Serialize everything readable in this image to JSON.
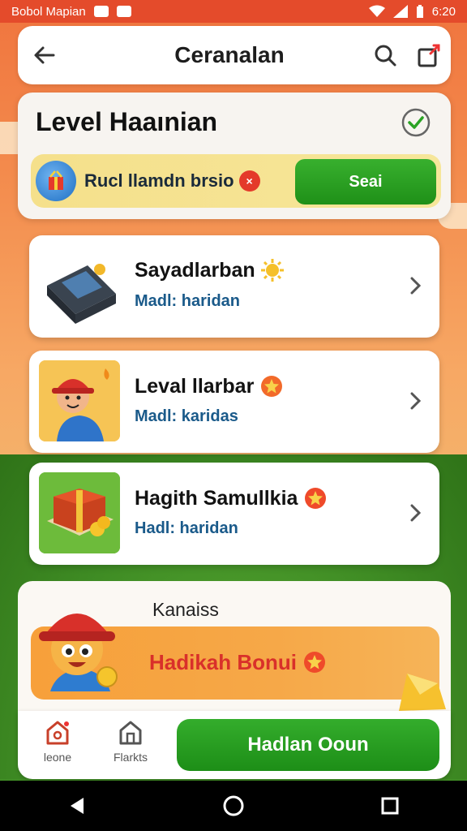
{
  "status_bar": {
    "left_text": "Bobol Mapian",
    "time": "6:20"
  },
  "header": {
    "title": "Ceranalan"
  },
  "level": {
    "title": "Level Haaınian",
    "promo_text": "Rucl llamdn brsio",
    "promo_badge": "×",
    "send_label": "Seai"
  },
  "tasks": [
    {
      "title": "Sayadlarban",
      "subtitle": "Madl: haridan"
    },
    {
      "title": "Leval llarbar",
      "subtitle": "Madl: karidas"
    },
    {
      "title": "Hagith Samullkia",
      "subtitle": "Hadl: haridan"
    }
  ],
  "bonus": {
    "label": "Kanaiss",
    "title": "Hadikah Bonui"
  },
  "bottom_nav": {
    "home_label": "leone",
    "shop_label": "Flarkts",
    "claim_label": "Hadlan Ooun"
  },
  "colors": {
    "status_bar": "#e44b2b",
    "primary_green": "#2aa324",
    "bonus_orange": "#f7a03a",
    "bonus_text": "#d9302a"
  }
}
